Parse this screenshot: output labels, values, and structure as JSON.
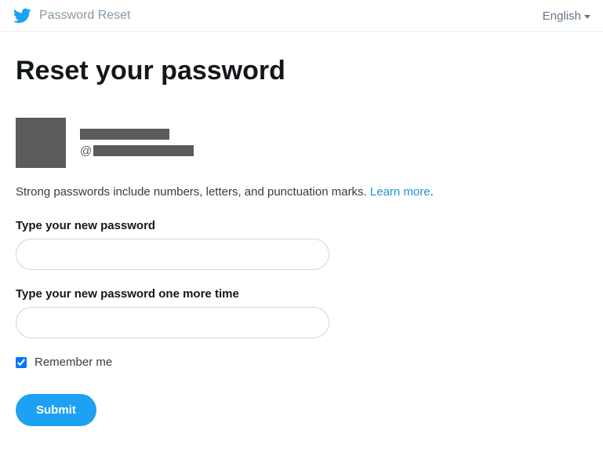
{
  "header": {
    "title": "Password Reset",
    "language": "English"
  },
  "main": {
    "heading": "Reset your password",
    "user": {
      "handle_prefix": "@"
    },
    "help_text": "Strong passwords include numbers, letters, and punctuation marks. ",
    "help_link": "Learn more",
    "help_suffix": ".",
    "fields": {
      "new_password_label": "Type your new password",
      "confirm_password_label": "Type your new password one more time"
    },
    "remember_label": "Remember me",
    "remember_checked": true,
    "submit_label": "Submit"
  }
}
